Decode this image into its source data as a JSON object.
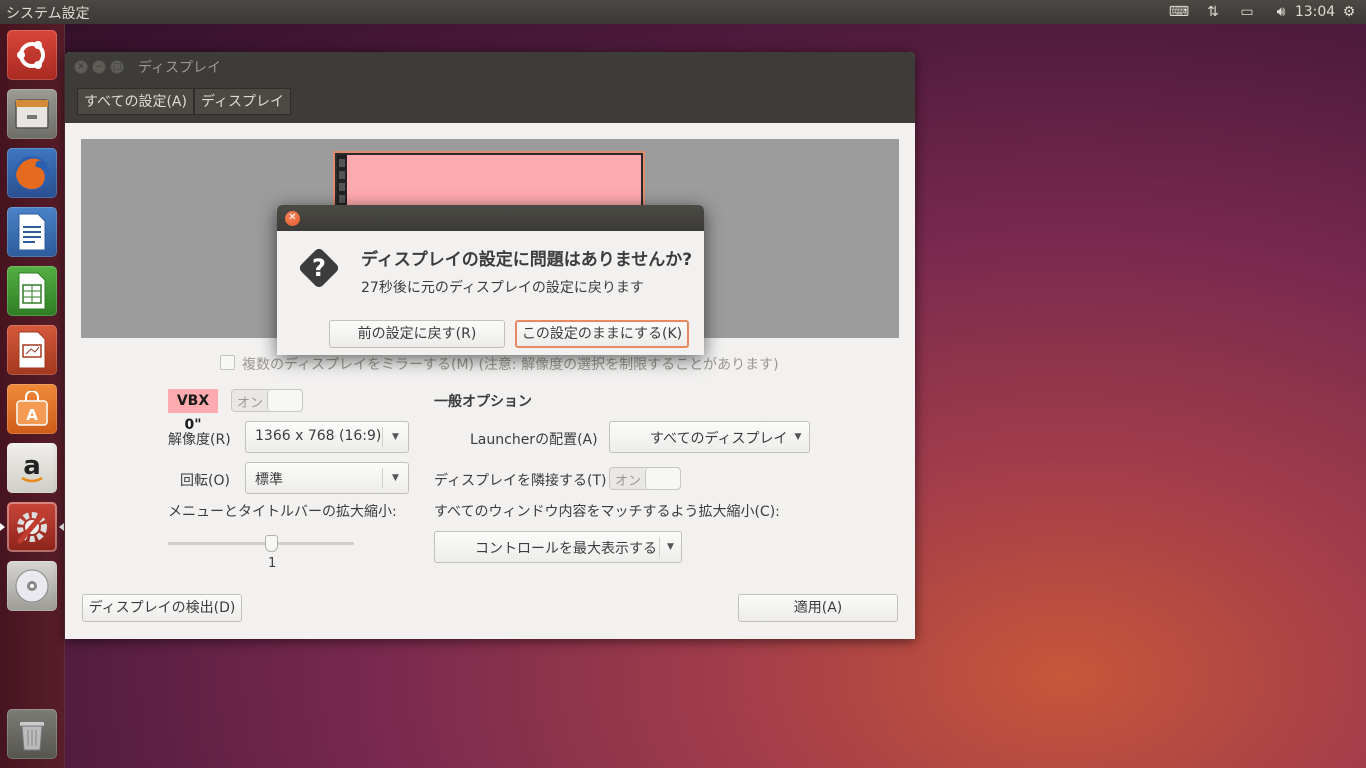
{
  "top_panel": {
    "app_title": "システム設定",
    "clock": "13:04",
    "indicators": [
      "keyboard-icon",
      "network-icon",
      "battery-icon",
      "volume-icon",
      "gear-icon"
    ]
  },
  "launcher": {
    "items": [
      {
        "name": "ubuntu-logo-icon",
        "color": "#c8362c"
      },
      {
        "name": "files-icon",
        "color": "#8a8a84"
      },
      {
        "name": "firefox-icon",
        "color": "#e56a1c"
      },
      {
        "name": "writer-icon",
        "color": "#2f6cb3"
      },
      {
        "name": "calc-icon",
        "color": "#3e9b2e"
      },
      {
        "name": "impress-icon",
        "color": "#c4452b"
      },
      {
        "name": "software-center-icon",
        "color": "#e8752a"
      },
      {
        "name": "amazon-icon",
        "color": "#e6e4df"
      },
      {
        "name": "system-settings-icon",
        "color": "#b8342a"
      },
      {
        "name": "dvd-icon",
        "color": "#c9c9c9"
      },
      {
        "name": "trash-icon",
        "color": "#8f8f8a"
      }
    ]
  },
  "window": {
    "title": "ディスプレイ",
    "nav": {
      "all_settings": "すべての設定(A)",
      "current": "ディスプレイ"
    }
  },
  "display": {
    "mirror_label": "複数のディスプレイをミラーする(M) (注意: 解像度の選択を制限することがあります)",
    "monitor_name": "VBX 0\"",
    "monitor_toggle": "オン",
    "resolution_label": "解像度(R)",
    "resolution_value": "1366 x 768 (16:9)",
    "rotation_label": "回転(O)",
    "rotation_value": "標準",
    "scale_label": "メニューとタイトルバーの拡大縮小:",
    "scale_value": "1",
    "general_options": "一般オプション",
    "launcher_label": "Launcherの配置(A)",
    "launcher_value": "すべてのディスプレイ",
    "sticky_label": "ディスプレイを隣接する(T)",
    "sticky_toggle": "オン",
    "scale_all_label": "すべてのウィンドウ内容をマッチするよう拡大縮小(C):",
    "scale_all_value": "コントロールを最大表示する",
    "detect_button": "ディスプレイの検出(D)",
    "apply_button": "適用(A)"
  },
  "dialog": {
    "heading": "ディスプレイの設定に問題はありませんか?",
    "message": "27秒後に元のディスプレイの設定に戻ります",
    "revert_button": "前の設定に戻す(R)",
    "keep_button": "この設定のままにする(K)"
  }
}
